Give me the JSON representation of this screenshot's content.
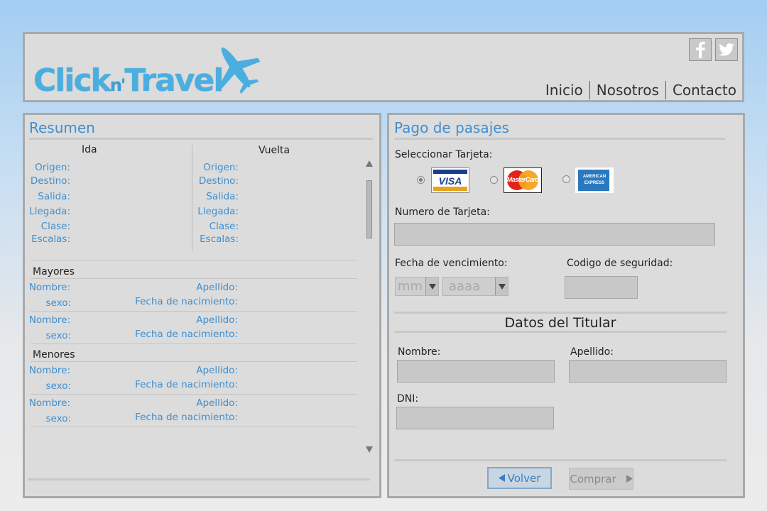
{
  "header": {
    "logo": {
      "text_click": "Click",
      "text_n": "n'",
      "text_travel": "Travel"
    },
    "social": [
      {
        "name": "facebook",
        "icon": "facebook-icon"
      },
      {
        "name": "twitter",
        "icon": "twitter-icon"
      }
    ],
    "nav": [
      "Inicio",
      "Nosotros",
      "Contacto"
    ]
  },
  "resumen": {
    "title": "Resumen",
    "ida": {
      "heading": "Ida",
      "labels": [
        "Origen:",
        "Destino:",
        "Salida:",
        "Llegada:",
        "Clase:",
        "Escalas:"
      ]
    },
    "vuelta": {
      "heading": "Vuelta",
      "labels": [
        "Origen:",
        "Destino:",
        "Salida:",
        "Llegada:",
        "Clase:",
        "Escalas:"
      ]
    },
    "mayores": {
      "heading": "Mayores",
      "nombre": "Nombre:",
      "apellido": "Apellido:",
      "sexo": "sexo:",
      "fecha": "Fecha de nacimiento:"
    },
    "menores": {
      "heading": "Menores",
      "nombre": "Nombre:",
      "apellido": "Apellido:",
      "sexo": "sexo:",
      "fecha": "Fecha de nacimiento:"
    }
  },
  "pago": {
    "title": "Pago de pasajes",
    "seleccionar": "Seleccionar Tarjeta:",
    "cards": [
      {
        "name": "VISA",
        "selected": true
      },
      {
        "name": "MasterCard",
        "selected": false
      },
      {
        "name": "AMERICAN EXPRESS",
        "selected": false
      }
    ],
    "numero_label": "Numero de Tarjeta:",
    "numero_value": "",
    "vencimiento_label": "Fecha de vencimiento:",
    "mes_placeholder": "mm",
    "anio_placeholder": "aaaa",
    "codigo_label": "Codigo de seguridad:",
    "titular": {
      "heading": "Datos del Titular",
      "nombre": "Nombre:",
      "apellido": "Apellido:",
      "dni": "DNI:"
    },
    "volver": "Volver",
    "comprar": "Comprar"
  },
  "colors": {
    "accent": "#3f8fd0",
    "panel": "#dcdcdc",
    "border": "#a9a9a9",
    "logo": "#4aaee0"
  }
}
